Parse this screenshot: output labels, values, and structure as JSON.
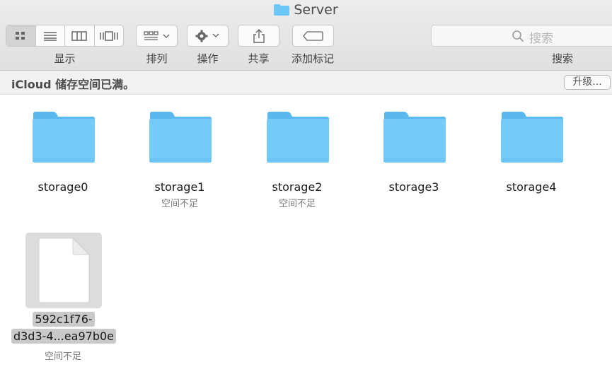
{
  "window": {
    "title": "Server"
  },
  "toolbar": {
    "view_label": "显示",
    "arrange_label": "排列",
    "action_label": "操作",
    "share_label": "共享",
    "tags_label": "添加标记",
    "search_label": "搜索",
    "search_placeholder": "搜索"
  },
  "banner": {
    "message": "iCloud 储存空间已满。",
    "upgrade_label": "升级..."
  },
  "items": [
    {
      "name": "storage0",
      "status": ""
    },
    {
      "name": "storage1",
      "status": "空间不足"
    },
    {
      "name": "storage2",
      "status": "空间不足"
    },
    {
      "name": "storage3",
      "status": ""
    },
    {
      "name": "storage4",
      "status": ""
    }
  ],
  "file": {
    "name_line1": "592c1f76-",
    "name_line2": "d3d3-4...ea97b0e",
    "status": "空间不足"
  },
  "colors": {
    "folder": "#6cc6f7",
    "selection": "#d6d6d6"
  }
}
